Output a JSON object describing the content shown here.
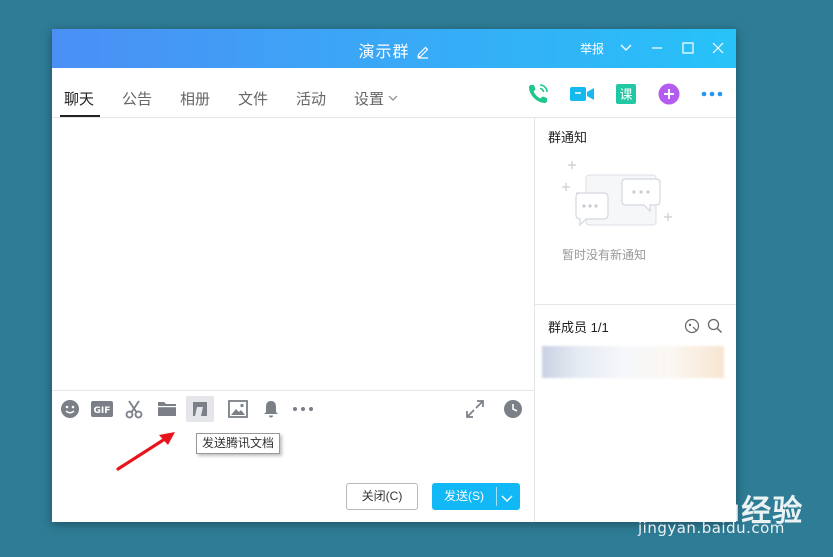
{
  "window": {
    "title": "演示群",
    "report_label": "举报"
  },
  "tabs": [
    {
      "label": "聊天",
      "active": true
    },
    {
      "label": "公告",
      "active": false
    },
    {
      "label": "相册",
      "active": false
    },
    {
      "label": "文件",
      "active": false
    },
    {
      "label": "活动",
      "active": false
    },
    {
      "label": "设置",
      "active": false
    }
  ],
  "top_icons": [
    "voice-call-icon",
    "video-call-icon",
    "class-icon",
    "add-app-icon",
    "more-icon"
  ],
  "toolbar": {
    "icons": [
      "emoji-icon",
      "gif-icon",
      "scissors-icon",
      "folder-icon",
      "tencent-doc-icon",
      "image-icon",
      "bell-icon",
      "more-dots-icon",
      "expand-icon",
      "history-clock-icon"
    ],
    "tooltip": "发送腾讯文档"
  },
  "buttons": {
    "close_label": "关闭(C)",
    "send_label": "发送(S)"
  },
  "side": {
    "notice_title": "群通知",
    "notice_empty": "暂时没有新通知",
    "members_title": "群成员 1/1"
  },
  "watermark": {
    "brand": "Baidu经验",
    "url": "jingyan.baidu.com"
  },
  "colors": {
    "titlebar_start": "#4b8ff5",
    "titlebar_end": "#27c2f8",
    "send_button": "#12b7f5",
    "background": "#2e7c96",
    "arrow": "#e8141b"
  }
}
